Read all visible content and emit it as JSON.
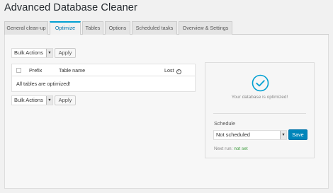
{
  "page": {
    "title": "Advanced Database Cleaner"
  },
  "tabs": [
    {
      "label": "General clean-up",
      "active": false
    },
    {
      "label": "Optimize",
      "active": true
    },
    {
      "label": "Tables",
      "active": false
    },
    {
      "label": "Options",
      "active": false
    },
    {
      "label": "Scheduled tasks",
      "active": false
    },
    {
      "label": "Overview & Settings",
      "active": false
    }
  ],
  "bulk_top": {
    "select_value": "Bulk Actions",
    "apply_label": "Apply"
  },
  "bulk_bottom": {
    "select_value": "Bulk Actions",
    "apply_label": "Apply"
  },
  "table": {
    "columns": [
      "Prefix",
      "Table name",
      "Lost"
    ],
    "empty_message": "All tables are optimized!"
  },
  "status": {
    "message": "Your database is optimized!",
    "schedule_label": "Schedule",
    "schedule_value": "Not scheduled",
    "save_label": "Save",
    "next_run_label": "Next run:",
    "next_run_value": "not set",
    "accent_color": "#00a0d2",
    "success_color": "#3a9a3a"
  }
}
